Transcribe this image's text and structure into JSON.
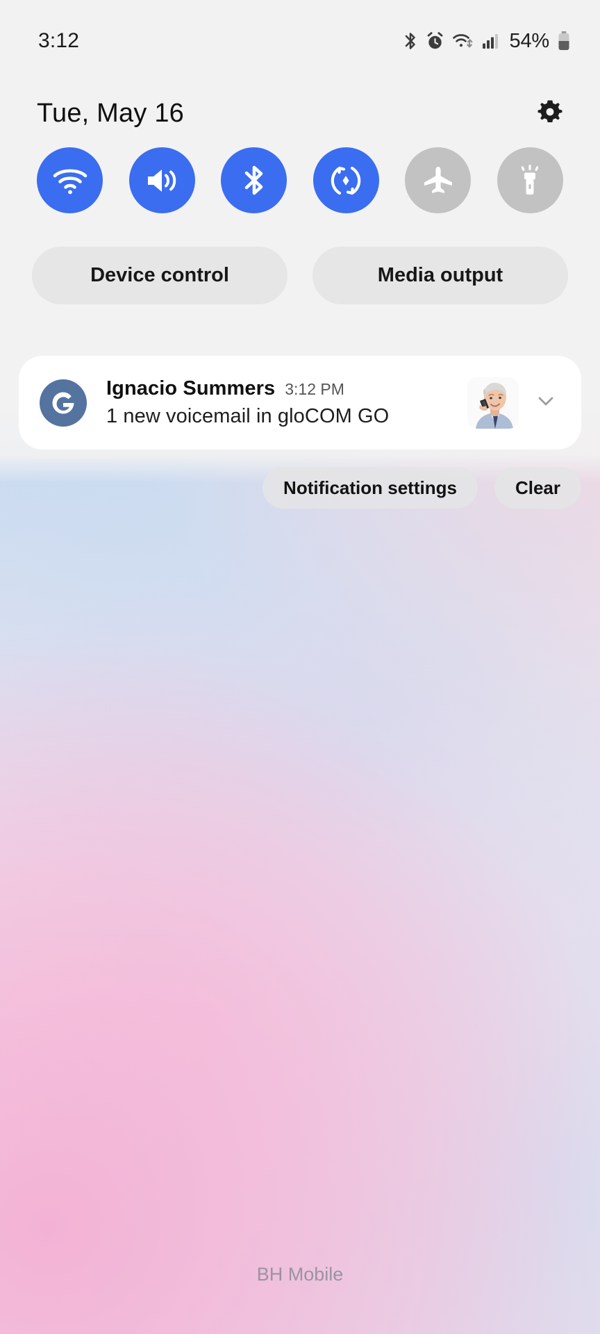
{
  "status_bar": {
    "time": "3:12",
    "battery_percent": "54%",
    "icons": [
      "bluetooth-icon",
      "alarm-icon",
      "wifi-icon",
      "cellular-signal-icon",
      "battery-icon"
    ]
  },
  "header": {
    "date": "Tue, May 16",
    "settings_icon": "gear-icon"
  },
  "quick_toggles": [
    {
      "name": "wifi",
      "icon": "wifi-icon",
      "state": "on",
      "color": "#3a6df0"
    },
    {
      "name": "sound",
      "icon": "volume-icon",
      "state": "on",
      "color": "#3a6df0"
    },
    {
      "name": "bluetooth",
      "icon": "bluetooth-icon",
      "state": "on",
      "color": "#3a6df0"
    },
    {
      "name": "auto-rotate",
      "icon": "auto-rotate-icon",
      "state": "on",
      "color": "#3a6df0"
    },
    {
      "name": "airplane",
      "icon": "airplane-icon",
      "state": "off",
      "color": "#c2c2c2"
    },
    {
      "name": "flashlight",
      "icon": "flashlight-icon",
      "state": "off",
      "color": "#c2c2c2"
    }
  ],
  "pill_buttons": {
    "device_control": "Device control",
    "media_output": "Media output"
  },
  "notification": {
    "app_icon_letter": "G",
    "app_icon_color": "#54739f",
    "title": "Ignacio Summers",
    "time": "3:12 PM",
    "body": "1 new voicemail in gloCOM GO",
    "thumbnail": "contact-photo",
    "expand_icon": "chevron-down-icon"
  },
  "actions": {
    "notification_settings": "Notification settings",
    "clear": "Clear"
  },
  "footer": {
    "carrier": "BH Mobile"
  }
}
